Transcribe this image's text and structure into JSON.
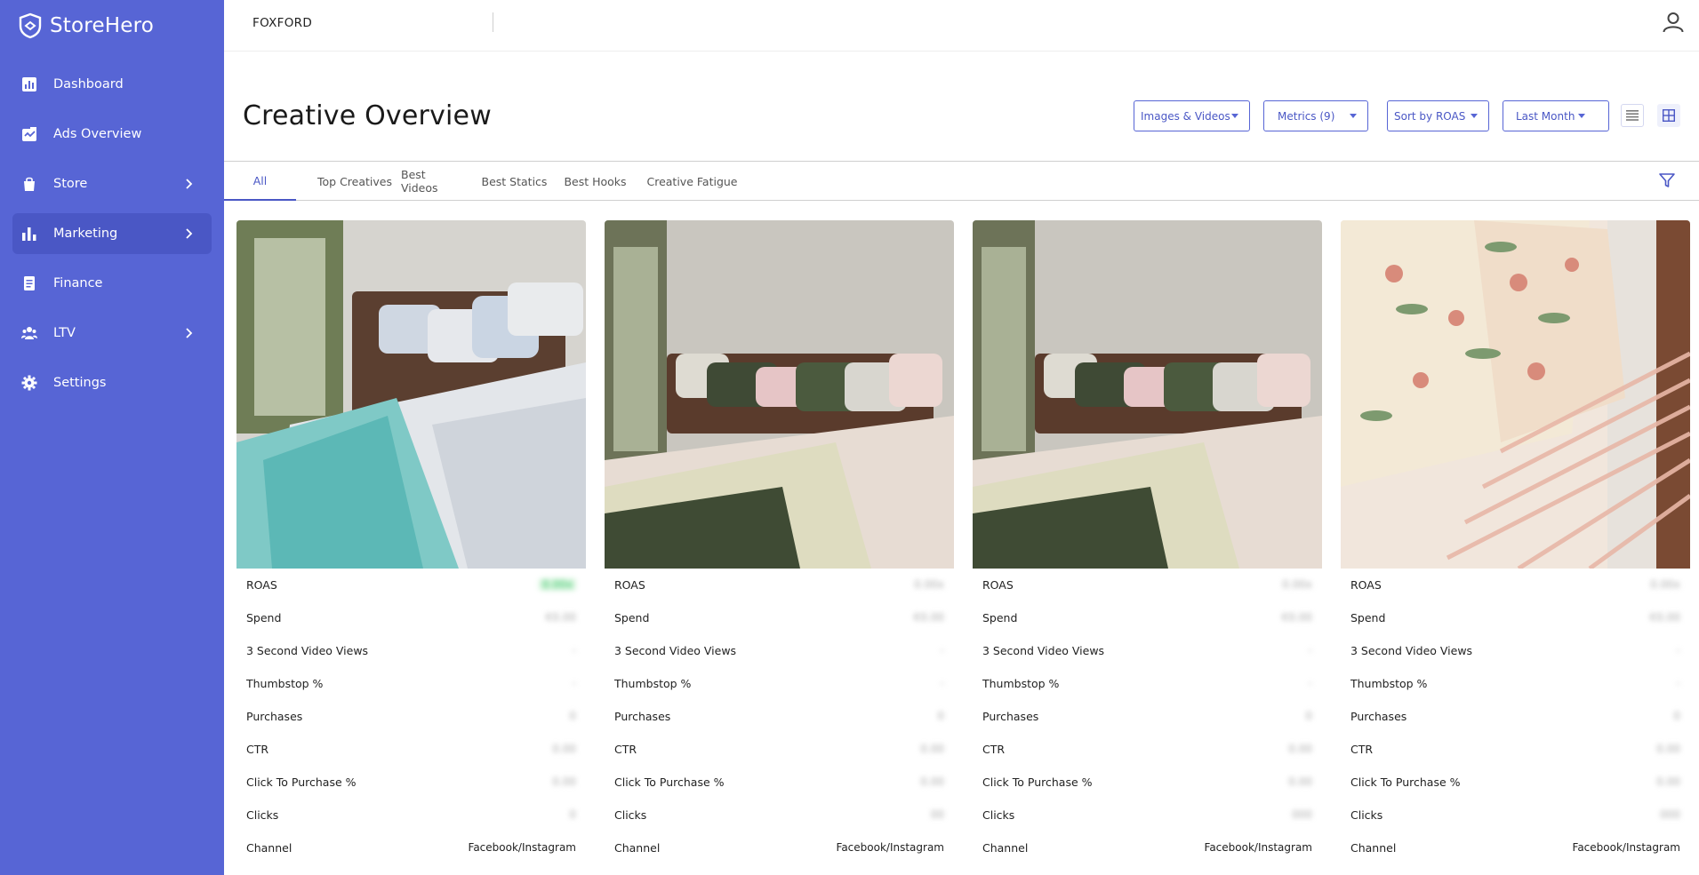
{
  "app": {
    "name": "StoreHero"
  },
  "sidebar": {
    "items": [
      {
        "label": "Dashboard",
        "icon": "bar-chart-icon"
      },
      {
        "label": "Ads Overview",
        "icon": "ads-icon"
      },
      {
        "label": "Store",
        "icon": "bag-icon",
        "expandable": true
      },
      {
        "label": "Marketing",
        "icon": "column-chart-icon",
        "expandable": true,
        "active": true
      },
      {
        "label": "Finance",
        "icon": "document-icon"
      },
      {
        "label": "LTV",
        "icon": "users-icon",
        "expandable": true
      },
      {
        "label": "Settings",
        "icon": "gear-icon"
      }
    ]
  },
  "topbar": {
    "store_name": "FOXFORD"
  },
  "header": {
    "title": "Creative Overview",
    "filters": {
      "media": "Images & Videos",
      "metrics": "Metrics (9)",
      "sort": "Sort by ROAS",
      "period": "Last Month"
    }
  },
  "tabs": [
    "All",
    "Top Creatives",
    "Best Videos",
    "Best Statics",
    "Best Hooks",
    "Creative Fatigue"
  ],
  "metric_labels": [
    "ROAS",
    "Spend",
    "3 Second Video Views",
    "Thumbstop %",
    "Purchases",
    "CTR",
    "Click To Purchase %",
    "Clicks",
    "Channel"
  ],
  "cards": [
    {
      "values": [
        "0.00x",
        "€0.00",
        "-",
        "-",
        "0",
        "0.00",
        "0.00",
        "0",
        "Facebook/Instagram"
      ]
    },
    {
      "values": [
        "0.00x",
        "€0.00",
        "-",
        "-",
        "0",
        "0.00",
        "0.00",
        "00",
        "Facebook/Instagram"
      ]
    },
    {
      "values": [
        "0.00x",
        "€0.00",
        "-",
        "-",
        "0",
        "0.00",
        "0.00",
        "000",
        "Facebook/Instagram"
      ]
    },
    {
      "values": [
        "0.00x",
        "€0.00",
        "-",
        "-",
        "0",
        "0.00",
        "0.00",
        "000",
        "Facebook/Instagram"
      ]
    }
  ],
  "colors": {
    "sidebar_bg": "#5765d5",
    "accent": "#4a57c5",
    "roas_good": "#3ac46a"
  }
}
